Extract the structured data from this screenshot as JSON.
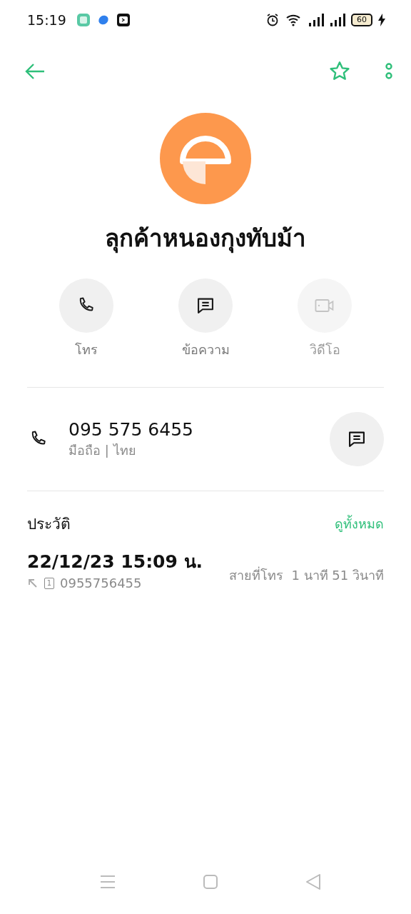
{
  "status_bar": {
    "time": "15:19",
    "battery": "60"
  },
  "toolbar": {
    "favorite": false
  },
  "contact": {
    "name": "ลุกค้าหนองกุงทับม้า"
  },
  "actions": [
    {
      "label": "โทร",
      "kind": "call",
      "disabled": false
    },
    {
      "label": "ข้อความ",
      "kind": "message",
      "disabled": false
    },
    {
      "label": "วิดีโอ",
      "kind": "video",
      "disabled": true
    }
  ],
  "phone": {
    "number": "095 575 6455",
    "type": "มือถือ | ไทย"
  },
  "history": {
    "title": "ประวัติ",
    "view_all": "ดูทั้งหมด",
    "entries": [
      {
        "datetime": "22/12/23 15:09 น.",
        "sim": "1",
        "number": "0955756455",
        "duration": "สายที่โทร  1 นาที 51 วินาที"
      }
    ]
  }
}
